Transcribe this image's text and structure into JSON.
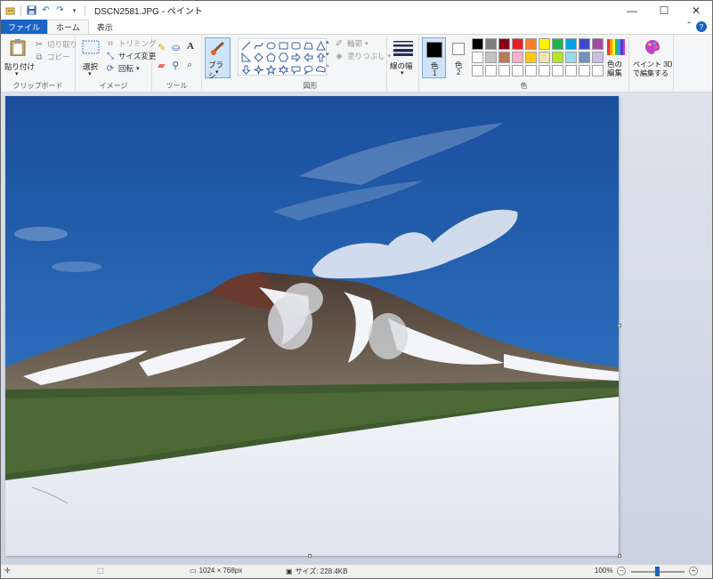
{
  "window": {
    "title": "DSCN2581.JPG - ペイント"
  },
  "tabs": [
    {
      "label": "ファイル"
    },
    {
      "label": "ホーム"
    },
    {
      "label": "表示"
    }
  ],
  "ribbon": {
    "clipboard": {
      "group_label": "クリップボード",
      "paste_label": "貼り付け",
      "cut_label": "切り取り",
      "copy_label": "コピー"
    },
    "image": {
      "group_label": "イメージ",
      "select_label": "選択",
      "crop_label": "トリミング",
      "resize_label": "サイズ変更",
      "rotate_label": "回転"
    },
    "tools": {
      "group_label": "ツール"
    },
    "brushes": {
      "label": "ブラシ"
    },
    "shapes": {
      "group_label": "図形",
      "outline_label": "輪郭",
      "fill_label": "塗りつぶし"
    },
    "size": {
      "label": "線の幅"
    },
    "colors": {
      "group_label": "色",
      "color1_label": "色",
      "color1_num": "1",
      "color2_label": "色",
      "color2_num": "2",
      "edit_colors_label_1": "色の",
      "edit_colors_label_2": "編集",
      "color1_value": "#000000",
      "color2_value": "#ffffff",
      "palette_row1": [
        "#000000",
        "#7f7f7f",
        "#880015",
        "#ed1c24",
        "#ff7f27",
        "#fff200",
        "#22b14c",
        "#00a2e8",
        "#3f48cc",
        "#a349a4"
      ],
      "palette_row2": [
        "#ffffff",
        "#c3c3c3",
        "#b97a57",
        "#ffaec9",
        "#ffc90e",
        "#efe4b0",
        "#b5e61d",
        "#99d9ea",
        "#7092be",
        "#c8bfe7"
      ],
      "palette_row3": [
        "#ffffff",
        "#ffffff",
        "#ffffff",
        "#ffffff",
        "#ffffff",
        "#ffffff",
        "#ffffff",
        "#ffffff",
        "#ffffff",
        "#ffffff"
      ]
    },
    "paint3d": {
      "label_1": "ペイント 3D",
      "label_2": "で編集する"
    }
  },
  "status": {
    "dimensions": "1024 × 768px",
    "size": "サイズ: 228.4KB",
    "zoom": "100%"
  }
}
